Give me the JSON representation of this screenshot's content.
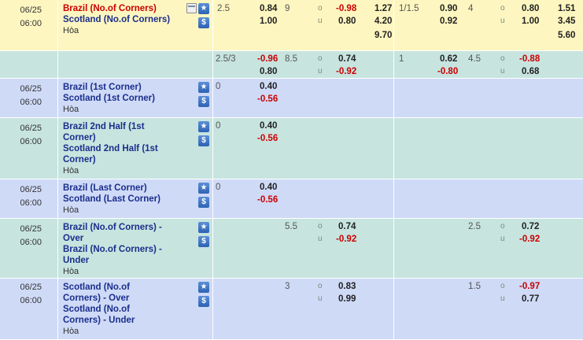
{
  "rows": [
    {
      "date": "06/25",
      "time": "06:00",
      "home": "Brazil (No.of Corners)",
      "away": "Scotland (No.of Corners)",
      "draw": "Hòa",
      "hc1": "2.5",
      "h1": "0.84",
      "a1": "1.00",
      "ou1": "9",
      "o1": "-0.98",
      "u1": "0.80",
      "x1": "1.27",
      "x2": "4.20",
      "x3": "9.70",
      "hc2": "1/1.5",
      "h2": "0.90",
      "a2": "0.92",
      "ou2": "4",
      "o2": "0.80",
      "u2": "1.00",
      "y1": "1.51",
      "y2": "3.45",
      "y3": "5.60",
      "o_label": "o",
      "u_label": "u"
    },
    {
      "hc1": "2.5/3",
      "h1": "-0.96",
      "a1": "0.80",
      "ou1": "8.5",
      "o1": "0.74",
      "u1": "-0.92",
      "hc2": "1",
      "h2": "0.62",
      "a2": "-0.80",
      "ou2": "4.5",
      "o2": "-0.88",
      "u2": "0.68",
      "o_label": "o",
      "u_label": "u"
    },
    {
      "date": "06/25",
      "time": "06:00",
      "home": "Brazil (1st Corner)",
      "away": "Scotland (1st Corner)",
      "draw": "Hòa",
      "hc1": "0",
      "h1": "0.40",
      "a1": "-0.56"
    },
    {
      "date": "06/25",
      "time": "06:00",
      "home": "Brazil 2nd Half (1st Corner)",
      "away": "Scotland 2nd Half (1st Corner)",
      "draw": "Hòa",
      "hc1": "0",
      "h1": "0.40",
      "a1": "-0.56"
    },
    {
      "date": "06/25",
      "time": "06:00",
      "home": "Brazil (Last Corner)",
      "away": "Scotland (Last Corner)",
      "draw": "Hòa",
      "hc1": "0",
      "h1": "0.40",
      "a1": "-0.56"
    },
    {
      "date": "06/25",
      "time": "06:00",
      "home": "Brazil (No.of Corners) - Over",
      "away": "Brazil (No.of Corners) - Under",
      "draw": "Hòa",
      "ou1": "5.5",
      "o1": "0.74",
      "u1": "-0.92",
      "ou2": "2.5",
      "o2": "0.72",
      "u2": "-0.92",
      "o_label": "o",
      "u_label": "u"
    },
    {
      "date": "06/25",
      "time": "06:00",
      "home": "Scotland (No.of Corners) - Over",
      "away": "Scotland (No.of Corners) - Under",
      "draw": "Hòa",
      "ou1": "3",
      "o1": "0.83",
      "u1": "0.99",
      "ou2": "1.5",
      "o2": "-0.97",
      "u2": "0.77",
      "o_label": "o",
      "u_label": "u"
    }
  ],
  "icons": {
    "calendar": "calendar-icon",
    "star": "star-icon",
    "dollar": "dollar-icon"
  },
  "icon_glyphs": {
    "star": "★",
    "dollar": "$"
  },
  "colors": {
    "yellow_row": "#fdf6c0",
    "teal_row": "#c7e4df",
    "blue_row": "#cfdaf7",
    "negative": "#cc0000",
    "team": "#1a2e8c"
  }
}
